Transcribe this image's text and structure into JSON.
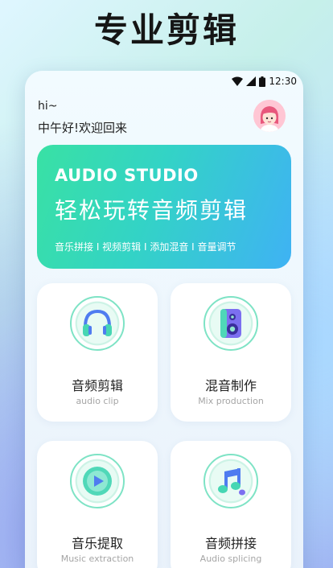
{
  "promo": {
    "title": "专业剪辑"
  },
  "status": {
    "time": "12:30"
  },
  "header": {
    "hi": "hi~",
    "greeting": "中午好!欢迎回来"
  },
  "banner": {
    "brand": "AUDIO STUDIO",
    "headline": "轻松玩转音频剪辑",
    "tags": "音乐拼接 I 视频剪辑 I 添加混音 I 音量调节"
  },
  "cards": [
    {
      "label": "音频剪辑",
      "sub": "audio clip"
    },
    {
      "label": "混音制作",
      "sub": "Mix production"
    },
    {
      "label": "音乐提取",
      "sub": "Music extraction"
    },
    {
      "label": "音频拼接",
      "sub": "Audio splicing"
    }
  ],
  "colors": {
    "accent_green": "#39e1a4",
    "accent_blue": "#3fb2f4"
  }
}
